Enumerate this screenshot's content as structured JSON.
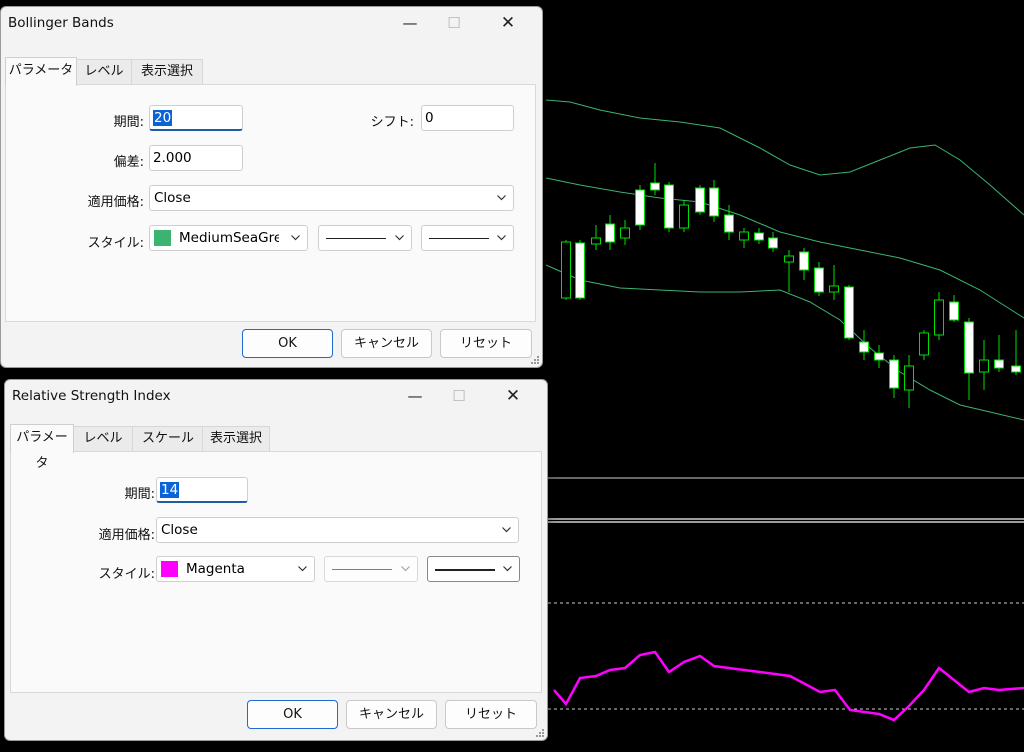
{
  "chart_area": {
    "name": "price-chart"
  },
  "bollinger": {
    "title": "Bollinger Bands",
    "window_buttons": {
      "minimize": "—",
      "maximize": "☐",
      "close": "✕"
    },
    "tabs": [
      "パラメータ",
      "レベル",
      "表示選択"
    ],
    "period_label": "期間:",
    "period_value": "20",
    "shift_label": "シフト:",
    "shift_value": "0",
    "deviation_label": "偏差:",
    "deviation_value": "2.000",
    "price_label": "適用価格:",
    "price_value": "Close",
    "style_label": "スタイル:",
    "color_name": "MediumSeaGree",
    "color_hex": "#3cb371",
    "ok": "OK",
    "cancel": "キャンセル",
    "reset": "リセット"
  },
  "rsi": {
    "title": "Relative Strength Index",
    "window_buttons": {
      "minimize": "—",
      "maximize": "☐",
      "close": "✕"
    },
    "tabs": [
      "パラメータ",
      "レベル",
      "スケール",
      "表示選択"
    ],
    "period_label": "期間:",
    "period_value": "14",
    "price_label": "適用価格:",
    "price_value": "Close",
    "style_label": "スタイル:",
    "color_name": "Magenta",
    "color_hex": "#ff00ff",
    "ok": "OK",
    "cancel": "キャンセル",
    "reset": "リセット"
  }
}
